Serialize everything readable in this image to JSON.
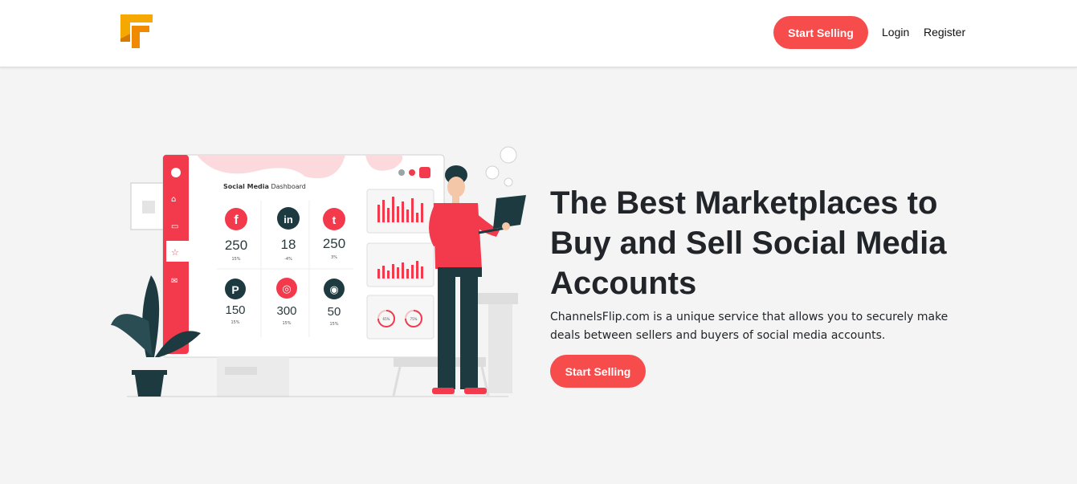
{
  "brand": {
    "logo_colors": [
      "#f5a800",
      "#f08a00"
    ]
  },
  "nav": {
    "start_selling": "Start Selling",
    "login": "Login",
    "register": "Register"
  },
  "dashboard": {
    "title_bold": "Social Media",
    "title_rest": " Dashboard",
    "stats": [
      {
        "icon": "facebook-icon",
        "glyph": "f",
        "value": "250",
        "sub": "15%"
      },
      {
        "icon": "linkedin-icon",
        "glyph": "in",
        "value": "18",
        "sub": "-4%"
      },
      {
        "icon": "twitter-icon",
        "glyph": "t",
        "value": "250",
        "sub": "3%"
      },
      {
        "icon": "pinterest-icon",
        "glyph": "P",
        "value": "150",
        "sub": "15%"
      },
      {
        "icon": "dribbble-icon",
        "glyph": "◎",
        "value": "300",
        "sub": "15%"
      },
      {
        "icon": "instagram-icon",
        "glyph": "◉",
        "value": "50",
        "sub": "15%"
      }
    ],
    "rings": [
      "65%",
      "75%"
    ]
  },
  "hero": {
    "title": "The Best Marketplaces to Buy and Sell Social Media Accounts",
    "description": "ChannelsFlip.com is a unique service that allows you to securely make deals between sellers and buyers of social media accounts.",
    "cta": "Start Selling"
  },
  "colors": {
    "accent": "#f64c4c",
    "dark": "#1d3a40",
    "background": "#f4f4f4"
  }
}
